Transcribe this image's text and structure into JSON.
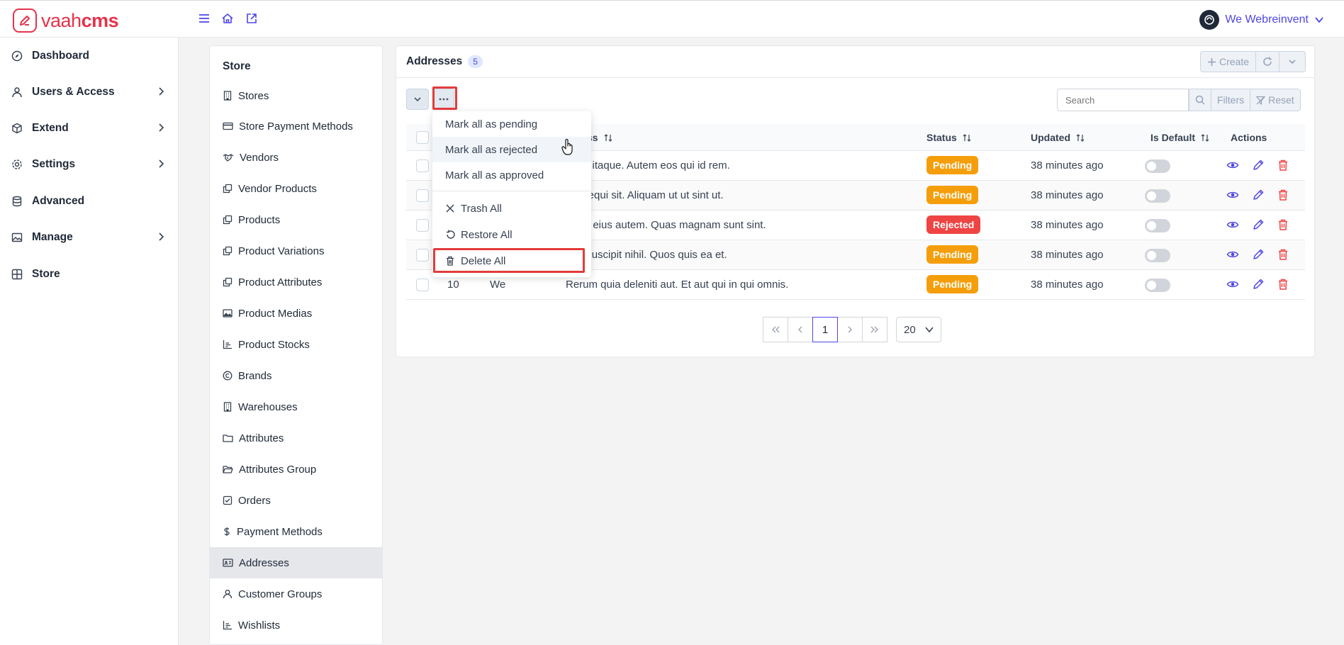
{
  "brand": {
    "name_light": "vaah",
    "name_bold": "cms",
    "color": "#e6334b"
  },
  "topbar": {
    "user_name": "We Webreinvent",
    "accent": "#4f46e5"
  },
  "sidebar": {
    "items": [
      {
        "label": "Dashboard",
        "icon": "compass-icon",
        "has_children": false
      },
      {
        "label": "Users & Access",
        "icon": "user-icon",
        "has_children": true
      },
      {
        "label": "Extend",
        "icon": "cube-icon",
        "has_children": true
      },
      {
        "label": "Settings",
        "icon": "gear-icon",
        "has_children": true
      },
      {
        "label": "Advanced",
        "icon": "database-icon",
        "has_children": false
      },
      {
        "label": "Manage",
        "icon": "image-icon",
        "has_children": true
      },
      {
        "label": "Store",
        "icon": "grid-icon",
        "has_children": false
      }
    ]
  },
  "store_menu": {
    "title": "Store",
    "items": [
      {
        "label": "Stores",
        "icon": "building-icon"
      },
      {
        "label": "Store Payment Methods",
        "icon": "credit-card-icon"
      },
      {
        "label": "Vendors",
        "icon": "handshake-icon"
      },
      {
        "label": "Vendor Products",
        "icon": "clone-icon"
      },
      {
        "label": "Products",
        "icon": "clone-icon"
      },
      {
        "label": "Product Variations",
        "icon": "clone-icon"
      },
      {
        "label": "Product Attributes",
        "icon": "clone-icon"
      },
      {
        "label": "Product Medias",
        "icon": "image-icon"
      },
      {
        "label": "Product Stocks",
        "icon": "chart-bar-icon"
      },
      {
        "label": "Brands",
        "icon": "copyright-icon"
      },
      {
        "label": "Warehouses",
        "icon": "building-icon"
      },
      {
        "label": "Attributes",
        "icon": "folder-icon"
      },
      {
        "label": "Attributes Group",
        "icon": "folder-open-icon"
      },
      {
        "label": "Orders",
        "icon": "check-square-icon"
      },
      {
        "label": "Payment Methods",
        "icon": "dollar-icon"
      },
      {
        "label": "Addresses",
        "icon": "id-card-icon",
        "active": true
      },
      {
        "label": "Customer Groups",
        "icon": "user-icon"
      },
      {
        "label": "Wishlists",
        "icon": "chart-bar-icon"
      }
    ]
  },
  "panel": {
    "title": "Addresses",
    "count": "5",
    "create_label": "Create",
    "search_placeholder": "Search",
    "filters_label": "Filters",
    "reset_label": "Reset"
  },
  "table": {
    "headers": {
      "address": "ss",
      "status": "Status",
      "updated": "Updated",
      "is_default": "Is Default",
      "actions": "Actions"
    },
    "rows": [
      {
        "id": "",
        "name": "",
        "address": "ed at itaque. Autem eos qui id rem.",
        "status": "Pending",
        "updated": "38 minutes ago"
      },
      {
        "id": "",
        "name": "",
        "address": "i et sequi sit. Aliquam ut ut sint ut.",
        "status": "Pending",
        "updated": "38 minutes ago"
      },
      {
        "id": "",
        "name": "",
        "address": "scipit eius autem. Quas magnam sunt sint.",
        "status": "Rejected",
        "updated": "38 minutes ago"
      },
      {
        "id": "",
        "name": "",
        "address": "que suscipit nihil. Quos quis ea et.",
        "status": "Pending",
        "updated": "38 minutes ago"
      },
      {
        "id": "10",
        "name": "We",
        "address": "Rerum quia deleniti aut. Et aut qui in qui omnis.",
        "status": "Pending",
        "updated": "38 minutes ago"
      }
    ],
    "status_colors": {
      "Pending": "#f59e0b",
      "Rejected": "#ef4444"
    }
  },
  "pagination": {
    "current_page": "1",
    "per_page": "20"
  },
  "bulk_menu": {
    "items": [
      {
        "label": "Mark all as pending",
        "icon": ""
      },
      {
        "label": "Mark all as rejected",
        "icon": "",
        "hovered": true
      },
      {
        "label": "Mark all as approved",
        "icon": ""
      },
      {
        "label": "Trash All",
        "icon": "times-icon"
      },
      {
        "label": "Restore All",
        "icon": "undo-icon"
      },
      {
        "label": "Delete All",
        "icon": "trash-icon",
        "highlighted": true
      }
    ]
  }
}
